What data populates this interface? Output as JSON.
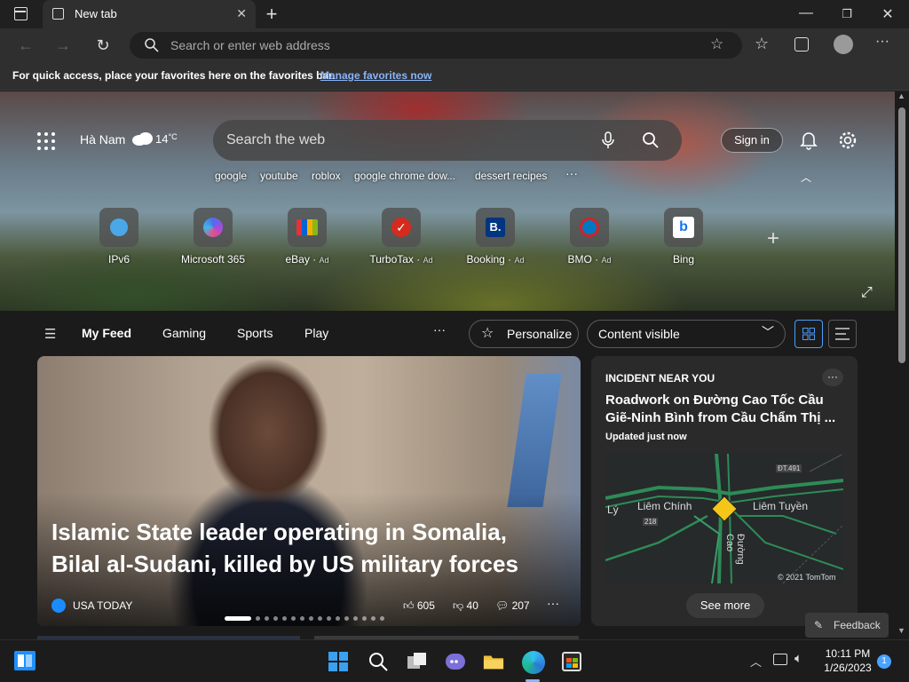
{
  "browser": {
    "tab_title": "New tab",
    "address_placeholder": "Search or enter web address"
  },
  "favorites_bar": {
    "message": "For quick access, place your favorites here on the favorites bar.",
    "link": "Manage favorites now"
  },
  "weather": {
    "location": "Hà Nam",
    "temperature": "14",
    "unit": "°C"
  },
  "search": {
    "placeholder": "Search the web",
    "suggestions": [
      "google",
      "youtube",
      "roblox",
      "google chrome dow...",
      "dessert recipes"
    ]
  },
  "header": {
    "signin_label": "Sign in"
  },
  "quick_links": [
    {
      "label": "IPv6",
      "ad": ""
    },
    {
      "label": "Microsoft 365",
      "ad": ""
    },
    {
      "label": "eBay",
      "ad": "Ad"
    },
    {
      "label": "TurboTax",
      "ad": "Ad"
    },
    {
      "label": "Booking",
      "ad": "Ad"
    },
    {
      "label": "BMO",
      "ad": "Ad"
    },
    {
      "label": "Bing",
      "ad": ""
    }
  ],
  "feed_nav": {
    "tabs": [
      "My Feed",
      "Gaming",
      "Sports",
      "Play"
    ],
    "personalize_label": "Personalize",
    "visibility_label": "Content visible"
  },
  "hero_story": {
    "headline": "Islamic State leader operating in Somalia, Bilal al-Sudani, killed by US military forces",
    "source": "USA TODAY",
    "likes": "605",
    "dislikes": "40",
    "comments": "207"
  },
  "incident": {
    "kicker": "INCIDENT NEAR YOU",
    "title": "Roadwork on Đường Cao Tốc Cầu Giẽ-Ninh Bình from Cầu Chẩm Thị ...",
    "updated": "Updated just now",
    "map_labels": [
      "Liêm Chính",
      "Liêm Tuyền",
      "Lý",
      "ĐT.491",
      "218",
      "Đường Cao"
    ],
    "map_copyright": "© 2021 TomTom",
    "see_more_label": "See more"
  },
  "feedback_label": "Feedback",
  "taskbar": {
    "time": "10:11 PM",
    "date": "1/26/2023",
    "notification_count": "1"
  }
}
